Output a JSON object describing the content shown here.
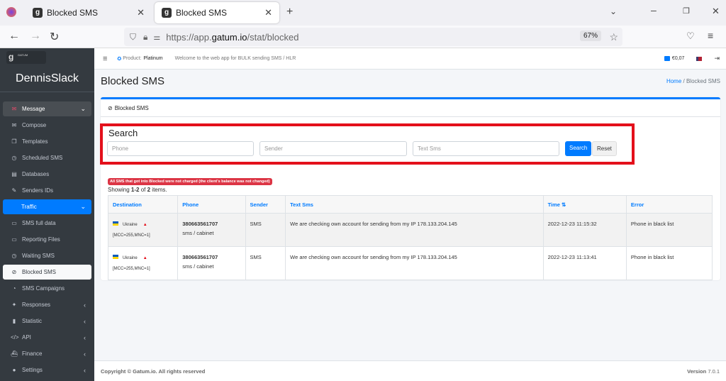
{
  "browser": {
    "tabs": [
      {
        "title": "Blocked SMS"
      },
      {
        "title": "Blocked SMS"
      }
    ],
    "url_prefix": "https://app.",
    "url_domain": "gatum.io",
    "url_path": "/stat/blocked",
    "zoom": "67%"
  },
  "sidebar": {
    "logo_text": "GATUM",
    "user": "DennisSlack",
    "items": [
      {
        "label": "Message",
        "icon": "envelope-icon",
        "glyph": "✉",
        "state": "open",
        "chevron": "⌄"
      },
      {
        "label": "Compose",
        "icon": "envelope-icon",
        "glyph": "✉"
      },
      {
        "label": "Templates",
        "icon": "copy-icon",
        "glyph": "❐"
      },
      {
        "label": "Scheduled SMS",
        "icon": "clock-icon",
        "glyph": "◷"
      },
      {
        "label": "Databases",
        "icon": "database-icon",
        "glyph": "▤"
      },
      {
        "label": "Senders IDs",
        "icon": "feather-icon",
        "glyph": "✎"
      },
      {
        "label": "Traffic",
        "state": "blue",
        "chevron": "⌄"
      },
      {
        "label": "SMS full data",
        "icon": "file-icon",
        "glyph": "▭"
      },
      {
        "label": "Reporting Files",
        "icon": "file-icon",
        "glyph": "▭"
      },
      {
        "label": "Waiting SMS",
        "icon": "clock-icon",
        "glyph": "◷"
      },
      {
        "label": "Blocked SMS",
        "icon": "ban-icon",
        "glyph": "⊘",
        "state": "cur"
      },
      {
        "label": "SMS Campaigns",
        "icon": "bullhorn-icon",
        "glyph": "◔"
      },
      {
        "label": "Responses",
        "icon": "reply-icon",
        "glyph": "✦",
        "chevron": "‹"
      },
      {
        "label": "Statistic",
        "icon": "chart-icon",
        "glyph": "▮",
        "chevron": "‹"
      },
      {
        "label": "API",
        "icon": "code-icon",
        "glyph": "</>",
        "chevron": "‹"
      },
      {
        "label": "Finance",
        "icon": "ship-icon",
        "glyph": "⛴",
        "chevron": "‹"
      },
      {
        "label": "Settings",
        "icon": "users-icon",
        "glyph": "●",
        "chevron": "‹"
      }
    ]
  },
  "topnav": {
    "product_label": "Product:",
    "product": "Platinum",
    "welcome": "Welcome to the web app for BULK sending SMS / HLR",
    "balance": "€0,07"
  },
  "page": {
    "title": "Blocked SMS",
    "breadcrumb_home": "Home",
    "breadcrumb_current": "Blocked SMS"
  },
  "card": {
    "header": "Blocked SMS",
    "search_title": "Search",
    "phone_placeholder": "Phone",
    "sender_placeholder": "Sender",
    "text_placeholder": "Text Sms",
    "search_button": "Search",
    "reset_button": "Reset",
    "notice": "All SMS that got into Blocked were not charged (the client's balance was not changed)",
    "showing_prefix": "Showing ",
    "showing_range": "1-2",
    "showing_of": " of ",
    "showing_total": "2",
    "showing_suffix": " items."
  },
  "table": {
    "columns": [
      "Destination",
      "Phone",
      "Sender",
      "Text Sms",
      "Time ⇅",
      "Error"
    ],
    "rows": [
      {
        "country": "Ukraine",
        "mccmnc": "[MCC=255,MNC=1]",
        "phone": "380663561707",
        "route": "sms / cabinet",
        "sender": "SMS",
        "text": "We are checking own account for sending from my IP 178.133.204.145",
        "time": "2022-12-23 11:15:32",
        "error": "Phone in black list"
      },
      {
        "country": "Ukraine",
        "mccmnc": "[MCC=255,MNC=1]",
        "phone": "380663561707",
        "route": "sms / cabinet",
        "sender": "SMS",
        "text": "We are checking own account for sending from my IP 178.133.204.145",
        "time": "2022-12-23 11:13:41",
        "error": "Phone in black list"
      }
    ]
  },
  "footer": {
    "copyright": "Copyright © Gatum.io. All rights reserved",
    "version_label": "Version",
    "version": "7.0.1"
  }
}
